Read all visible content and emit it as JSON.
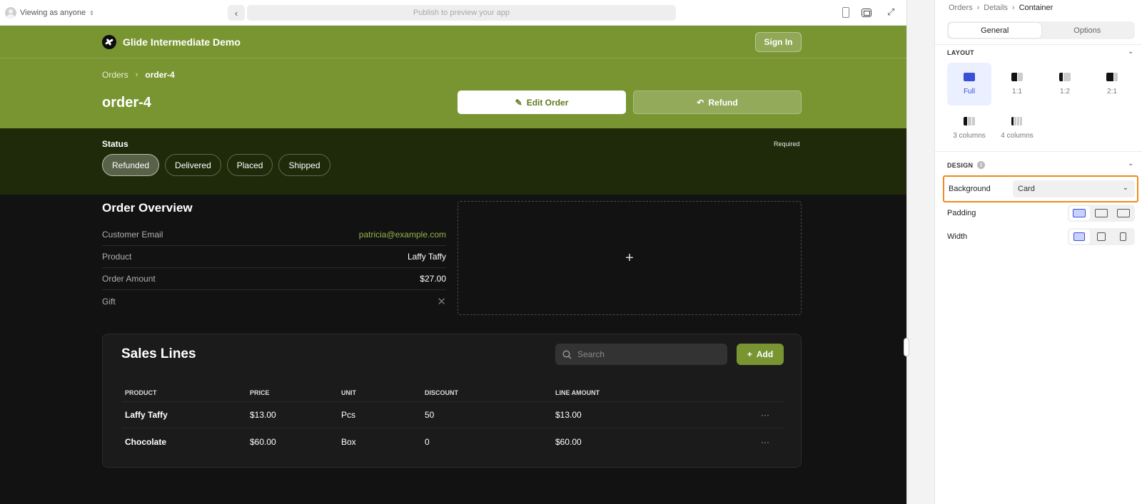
{
  "topbar": {
    "viewing_label": "Viewing as anyone",
    "url_placeholder": "Publish to preview your app"
  },
  "app": {
    "brand_name": "Glide Intermediate Demo",
    "signin_label": "Sign In",
    "breadcrumb": {
      "parent": "Orders",
      "current": "order-4"
    },
    "title": "order-4",
    "edit_label": "Edit Order",
    "refund_label": "Refund",
    "status": {
      "label": "Status",
      "required": "Required",
      "options": [
        "Refunded",
        "Delivered",
        "Placed",
        "Shipped"
      ],
      "selected": "Refunded"
    },
    "overview": {
      "title": "Order Overview",
      "rows": [
        {
          "label": "Customer Email",
          "value": "patricia@example.com"
        },
        {
          "label": "Product",
          "value": "Laffy Taffy"
        },
        {
          "label": "Order Amount",
          "value": "$27.00"
        },
        {
          "label": "Gift",
          "value": ""
        }
      ]
    },
    "sales_lines": {
      "title": "Sales Lines",
      "search_placeholder": "Search",
      "add_label": "Add",
      "columns": [
        "PRODUCT",
        "PRICE",
        "UNIT",
        "DISCOUNT",
        "LINE AMOUNT"
      ],
      "rows": [
        {
          "product": "Laffy Taffy",
          "price": "$13.00",
          "unit": "Pcs",
          "discount": "50",
          "line_amount": "$13.00"
        },
        {
          "product": "Chocolate",
          "price": "$60.00",
          "unit": "Box",
          "discount": "0",
          "line_amount": "$60.00"
        }
      ],
      "more_glyph": "···"
    }
  },
  "panel": {
    "breadcrumb": [
      "Orders",
      "Details",
      "Container"
    ],
    "tabs": [
      "General",
      "Options"
    ],
    "active_tab": "General",
    "layout": {
      "heading": "LAYOUT",
      "options": [
        "Full",
        "1:1",
        "1:2",
        "2:1",
        "3 columns",
        "4 columns"
      ],
      "selected": "Full"
    },
    "design": {
      "heading": "DESIGN",
      "background_label": "Background",
      "background_value": "Card",
      "padding_label": "Padding",
      "width_label": "Width"
    }
  },
  "colors": {
    "accent": "#799532",
    "status_band": "#1f2a0a",
    "highlight": "#f08a1c",
    "selection_blue": "#3a4fd8"
  }
}
